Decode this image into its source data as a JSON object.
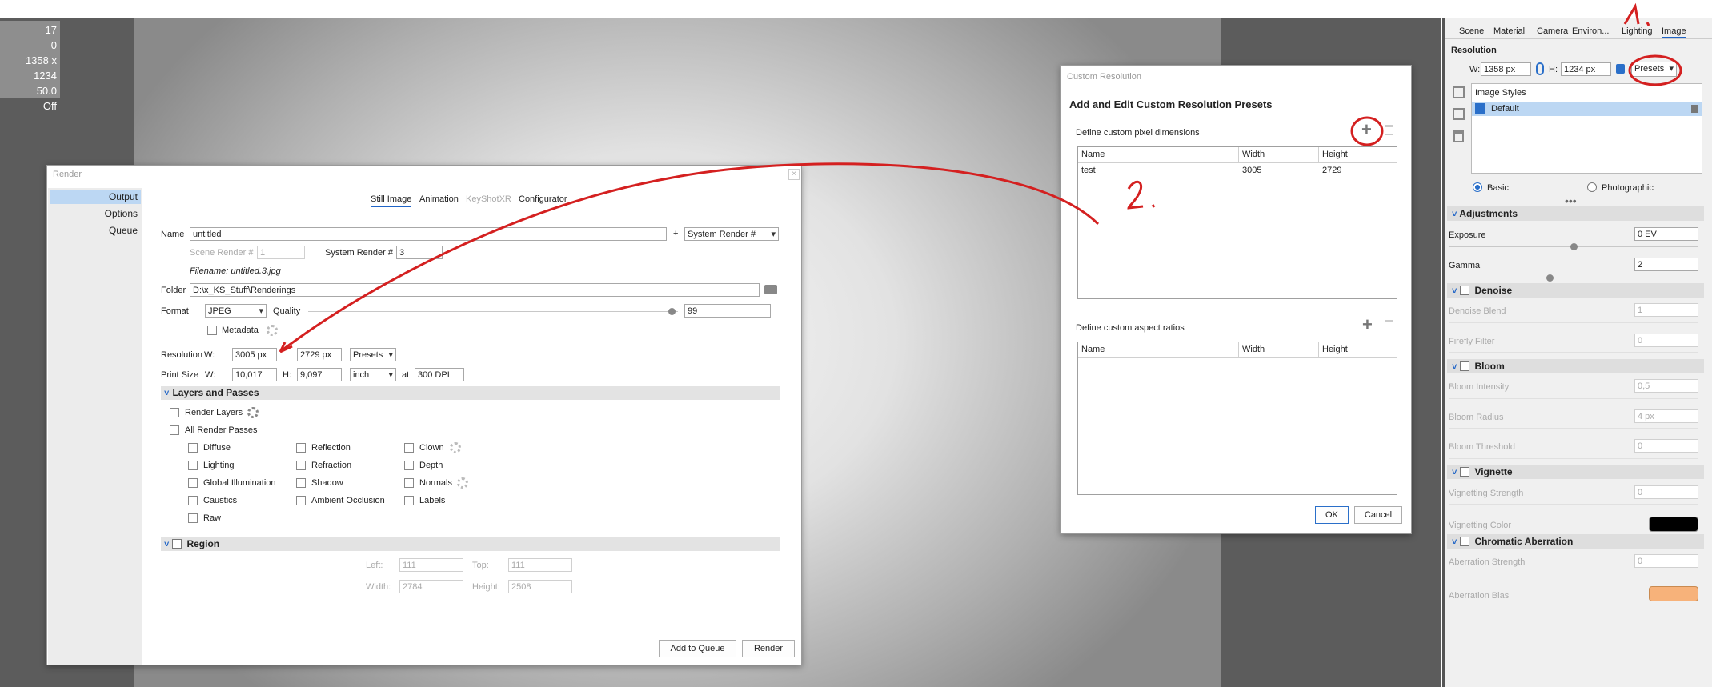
{
  "hud": {
    "values": [
      "17",
      "0",
      "1358 x 1234",
      "50.0",
      "Off"
    ]
  },
  "render": {
    "title": "Render",
    "sidebar": [
      "Output",
      "Options",
      "Queue"
    ],
    "tabs": [
      "Still Image",
      "Animation",
      "KeyShotXR",
      "Configurator"
    ],
    "name_label": "Name",
    "name_value": "untitled",
    "plus": "+",
    "system_render_select": "System Render #",
    "scene_render_label": "Scene Render #",
    "scene_render_value": "1",
    "system_render_label": "System Render #",
    "system_render_value": "3",
    "filename": "Filename: untitled.3.jpg",
    "folder_label": "Folder",
    "folder_value": "D:\\x_KS_Stuff\\Renderings",
    "format_label": "Format",
    "format_value": "JPEG",
    "quality_label": "Quality",
    "quality_value": "99",
    "metadata_label": "Metadata",
    "resolution_label": "Resolution",
    "w_label": "W:",
    "res_w": "3005 px",
    "h_label": "H:",
    "res_h": "2729 px",
    "presets": "Presets",
    "printsize_label": "Print Size",
    "print_w": "10,017",
    "print_h": "9,097",
    "unit": "inch",
    "at": "at",
    "dpi": "300 DPI",
    "layers_header": "Layers and Passes",
    "render_layers": "Render Layers",
    "all_passes": "All Render Passes",
    "passes_col1": [
      "Diffuse",
      "Lighting",
      "Global Illumination",
      "Caustics",
      "Raw"
    ],
    "passes_col2": [
      "Reflection",
      "Refraction",
      "Shadow",
      "Ambient Occlusion"
    ],
    "passes_col3": [
      "Clown",
      "Depth",
      "Normals",
      "Labels"
    ],
    "region_header": "Region",
    "left_label": "Left:",
    "left_value": "111",
    "top_label": "Top:",
    "top_value": "111",
    "width_label": "Width:",
    "width_value": "2784",
    "height_label": "Height:",
    "height_value": "2508",
    "add_queue": "Add to Queue",
    "render_btn": "Render"
  },
  "custom": {
    "title": "Custom Resolution",
    "heading": "Add and Edit Custom Resolution Presets",
    "pixel_label": "Define custom pixel dimensions",
    "cols": [
      "Name",
      "Width",
      "Height"
    ],
    "rows": [
      {
        "name": "test",
        "width": "3005",
        "height": "2729"
      }
    ],
    "aspect_label": "Define custom aspect ratios",
    "ok": "OK",
    "cancel": "Cancel"
  },
  "right": {
    "tabs": [
      "Scene",
      "Material",
      "Camera",
      "Environ...",
      "Lighting",
      "Image"
    ],
    "resolution_title": "Resolution",
    "w_label": "W:",
    "w_value": "1358 px",
    "h_label": "H:",
    "h_value": "1234 px",
    "presets": "Presets",
    "styles_header": "Image Styles",
    "style_default": "Default",
    "mode_basic": "Basic",
    "mode_photo": "Photographic",
    "adjustments": "Adjustments",
    "exposure_label": "Exposure",
    "exposure_value": "0 EV",
    "gamma_label": "Gamma",
    "gamma_value": "2",
    "denoise": "Denoise",
    "denoise_blend": "Denoise Blend",
    "denoise_blend_value": "1",
    "firefly": "Firefly Filter",
    "firefly_value": "0",
    "bloom": "Bloom",
    "bloom_intensity": "Bloom Intensity",
    "bloom_intensity_value": "0,5",
    "bloom_radius": "Bloom Radius",
    "bloom_radius_value": "4 px",
    "bloom_threshold": "Bloom Threshold",
    "bloom_threshold_value": "0",
    "vignette": "Vignette",
    "vignetting_strength": "Vignetting Strength",
    "vignetting_strength_value": "0",
    "vignetting_color": "Vignetting Color",
    "vignetting_color_hex": "#000000",
    "chromatic": "Chromatic Aberration",
    "aberration_strength": "Aberration Strength",
    "aberration_strength_value": "0",
    "aberration_bias": "Aberration Bias",
    "aberration_bias_hex": "#f7b27a"
  },
  "annotations": {
    "step1": "1.",
    "step2": "2.",
    "color": "#d42020"
  }
}
